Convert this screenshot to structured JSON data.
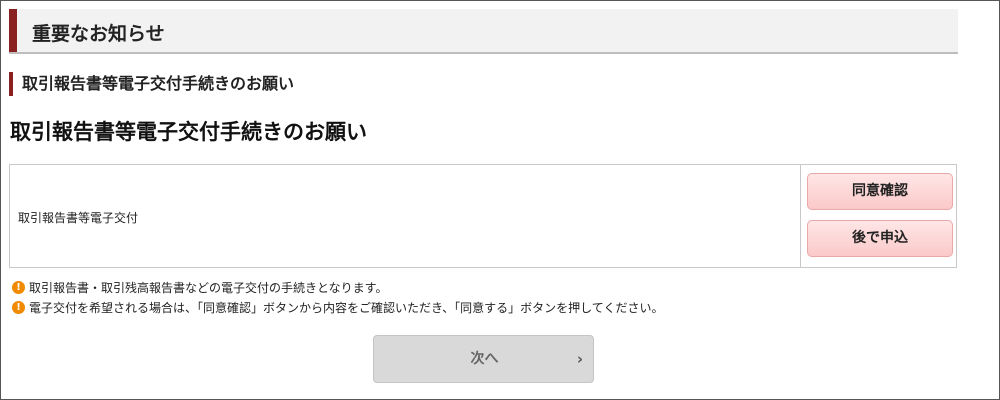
{
  "header": {
    "title": "重要なお知らせ"
  },
  "section": {
    "subheading": "取引報告書等電子交付手続きのお願い"
  },
  "main": {
    "heading": "取引報告書等電子交付手続きのお願い"
  },
  "procedure": {
    "name": "取引報告書等電子交付",
    "agree_button_label": "同意確認",
    "later_button_label": "後で申込"
  },
  "notes": [
    "取引報告書・取引残高報告書などの電子交付の手続きとなります。",
    "電子交付を希望される場合は、「同意確認」ボタンから内容をご確認いただき、「同意する」ボタンを押してください。"
  ],
  "icons": {
    "note": "exclamation-circle-icon",
    "next": "chevron-right-icon"
  },
  "next_button": {
    "label": "次へ",
    "disabled": true
  },
  "colors": {
    "accent": "#8b2020",
    "button_pink": "#fbc9c9",
    "note_icon": "#f08a00",
    "disabled_button": "#d9d9d9"
  }
}
